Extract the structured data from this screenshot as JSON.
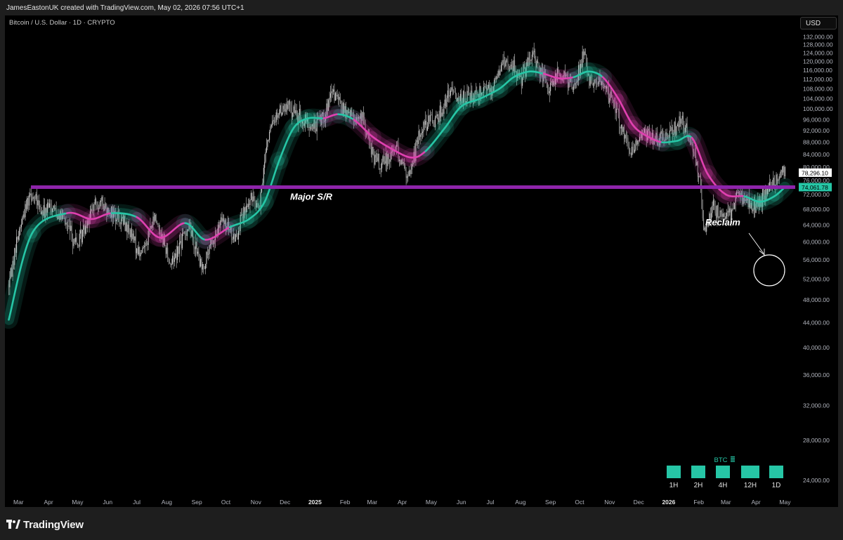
{
  "header": {
    "credit": "JamesEastonUK created with TradingView.com, May 02, 2026 07:56 UTC+1",
    "symbol": "Bitcoin / U.S. Dollar · 1D · CRYPTO",
    "currency": "USD"
  },
  "footer": {
    "brand": "TradingView"
  },
  "colors": {
    "background": "#000000",
    "candle": "#cfcfcf",
    "band_up": "#26c6a6",
    "band_down": "#e040b0",
    "sr_line": "#8e24aa",
    "price_label_bg": "#ffffff",
    "band_label_bg": "#26c6a6"
  },
  "chart_data": {
    "type": "line",
    "title": "Bitcoin / U.S. Dollar · 1D · CRYPTO",
    "xlabel": "",
    "ylabel": "",
    "y_scale": "log",
    "ylim": [
      22500,
      135000
    ],
    "grid": false,
    "y_ticks": [
      "132,000.00",
      "128,000.00",
      "124,000.00",
      "120,000.00",
      "116,000.00",
      "112,000.00",
      "108,000.00",
      "104,000.00",
      "100,000.00",
      "96,000.00",
      "92,000.00",
      "88,000.00",
      "84,000.00",
      "80,000.00",
      "76,000.00",
      "72,000.00",
      "68,000.00",
      "64,000.00",
      "60,000.00",
      "56,000.00",
      "52,000.00",
      "48,000.00",
      "44,000.00",
      "40,000.00",
      "36,000.00",
      "32,000.00",
      "28,000.00",
      "24,000.00"
    ],
    "x_ticks": [
      "Mar",
      "Apr",
      "May",
      "Jun",
      "Jul",
      "Aug",
      "Sep",
      "Oct",
      "Nov",
      "Dec",
      "2025",
      "Feb",
      "Mar",
      "Apr",
      "May",
      "Jun",
      "Jul",
      "Aug",
      "Sep",
      "Oct",
      "Nov",
      "Dec",
      "2026",
      "Feb",
      "Mar",
      "Apr",
      "May"
    ],
    "x_bold_ticks": [
      "2025",
      "2026"
    ],
    "price_path": {
      "x": [
        "2024-02-20",
        "2024-03-01",
        "2024-03-13",
        "2024-03-25",
        "2024-04-05",
        "2024-04-20",
        "2024-05-01",
        "2024-05-12",
        "2024-05-21",
        "2024-06-05",
        "2024-06-20",
        "2024-07-05",
        "2024-07-20",
        "2024-08-05",
        "2024-08-24",
        "2024-09-06",
        "2024-09-27",
        "2024-10-10",
        "2024-10-29",
        "2024-11-05",
        "2024-11-12",
        "2024-11-22",
        "2024-12-05",
        "2024-12-17",
        "2024-12-30",
        "2025-01-10",
        "2025-01-20",
        "2025-02-03",
        "2025-02-20",
        "2025-03-01",
        "2025-03-10",
        "2025-03-25",
        "2025-04-07",
        "2025-04-22",
        "2025-05-08",
        "2025-05-22",
        "2025-06-05",
        "2025-06-22",
        "2025-07-03",
        "2025-07-14",
        "2025-07-25",
        "2025-08-02",
        "2025-08-14",
        "2025-08-30",
        "2025-09-10",
        "2025-09-25",
        "2025-10-06",
        "2025-10-10",
        "2025-10-20",
        "2025-11-05",
        "2025-11-21",
        "2025-12-05",
        "2025-12-20",
        "2026-01-05",
        "2026-01-14",
        "2026-01-25",
        "2026-02-03",
        "2026-02-06",
        "2026-02-15",
        "2026-03-01",
        "2026-03-15",
        "2026-04-01",
        "2026-04-10",
        "2026-04-20",
        "2026-04-28",
        "2026-05-01"
      ],
      "y": [
        51000,
        62000,
        73000,
        67000,
        69000,
        64000,
        59000,
        66000,
        70000,
        67500,
        64000,
        57000,
        66000,
        55000,
        64000,
        54000,
        65000,
        61000,
        72000,
        68000,
        88000,
        98000,
        101000,
        96000,
        93000,
        98000,
        106000,
        98000,
        96000,
        84000,
        80000,
        87000,
        76500,
        94000,
        97000,
        107000,
        104000,
        108000,
        109000,
        120000,
        117000,
        113000,
        123000,
        108000,
        115000,
        109000,
        124000,
        112000,
        111000,
        104000,
        84000,
        92000,
        88000,
        91000,
        96000,
        88000,
        75000,
        62000,
        69000,
        65000,
        72000,
        68000,
        72000,
        76000,
        78000,
        78300
      ]
    },
    "moving_average": {
      "x": [
        "2024-02-20",
        "2024-03-15",
        "2024-04-20",
        "2024-05-15",
        "2024-06-05",
        "2024-07-01",
        "2024-07-25",
        "2024-08-20",
        "2024-09-10",
        "2024-10-05",
        "2024-10-25",
        "2024-11-10",
        "2024-11-25",
        "2024-12-10",
        "2024-12-25",
        "2025-01-10",
        "2025-01-25",
        "2025-02-10",
        "2025-03-01",
        "2025-03-20",
        "2025-04-10",
        "2025-04-25",
        "2025-05-15",
        "2025-06-01",
        "2025-06-20",
        "2025-07-10",
        "2025-07-25",
        "2025-08-10",
        "2025-08-25",
        "2025-09-10",
        "2025-09-25",
        "2025-10-10",
        "2025-10-25",
        "2025-11-10",
        "2025-11-25",
        "2025-12-10",
        "2025-12-25",
        "2026-01-10",
        "2026-01-25",
        "2026-02-10",
        "2026-03-01",
        "2026-03-20",
        "2026-04-05",
        "2026-04-20",
        "2026-05-01"
      ],
      "y": [
        44500,
        62000,
        67000,
        65500,
        67000,
        66000,
        61000,
        64500,
        60500,
        63500,
        65500,
        70000,
        82000,
        93000,
        96500,
        96500,
        98000,
        96000,
        90000,
        86000,
        83000,
        85000,
        93000,
        101000,
        104000,
        108000,
        113000,
        115500,
        114500,
        112500,
        113000,
        115500,
        113000,
        104000,
        94000,
        90000,
        88000,
        88500,
        89500,
        78000,
        72000,
        71500,
        70000,
        71500,
        74100
      ],
      "regime": [
        "up",
        "up",
        "down",
        "down",
        "up",
        "down",
        "down",
        "up",
        "down",
        "up",
        "up",
        "up",
        "up",
        "up",
        "up",
        "down",
        "up",
        "down",
        "down",
        "down",
        "down",
        "up",
        "up",
        "up",
        "up",
        "up",
        "up",
        "up",
        "down",
        "down",
        "up",
        "up",
        "down",
        "down",
        "down",
        "down",
        "up",
        "up",
        "down",
        "down",
        "down",
        "up",
        "up",
        "up",
        "up"
      ]
    },
    "support_resistance": {
      "value": 74061.78,
      "label": "Major S/R"
    },
    "last_price": {
      "value": 78296.1,
      "label": "78,296.10"
    },
    "band_last": {
      "value": 74061.78,
      "label": "74,061.78"
    },
    "annotations": [
      {
        "text": "Reclaim",
        "x": "2026-04-25",
        "y": 78300
      },
      {
        "text": "Major S/R",
        "x": "2024-12-05",
        "y": 74061.78
      }
    ],
    "mtf_panel": {
      "title": "BTC",
      "timeframes": [
        "1H",
        "2H",
        "4H",
        "12H",
        "1D"
      ],
      "status": [
        "up",
        "up",
        "up",
        "up",
        "up"
      ]
    }
  }
}
